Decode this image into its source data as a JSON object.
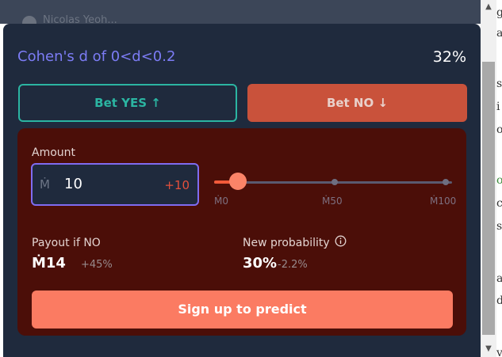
{
  "background": {
    "user_name": "Nicolas Yeoh...",
    "edge_glyphs": [
      "g",
      "a",
      "s",
      "i",
      "o",
      "o",
      "c",
      "s",
      "a",
      "d",
      "v"
    ]
  },
  "market": {
    "title": "Cohen's d of 0<d<0.2",
    "probability": "32%"
  },
  "bet_yes": {
    "label": "Bet YES ↑"
  },
  "bet_no": {
    "label": "Bet NO ↓"
  },
  "amount": {
    "label": "Amount",
    "currency_symbol": "Ṁ",
    "value": "10",
    "increment": "+10"
  },
  "slider": {
    "ticks": [
      "Ṁ0",
      "Ṁ50",
      "Ṁ100"
    ],
    "value_fraction": 0.1
  },
  "payout": {
    "label": "Payout if NO",
    "value": "Ṁ14",
    "change": "+45%"
  },
  "new_probability": {
    "label": "New probability",
    "value": "30%",
    "change": "-2.2%"
  },
  "signup_button": {
    "label": "Sign up to predict"
  },
  "colors": {
    "yes": "#2bb5a2",
    "no": "#c9523b",
    "accent": "#7c7cf5",
    "signup": "#fb7b62"
  }
}
